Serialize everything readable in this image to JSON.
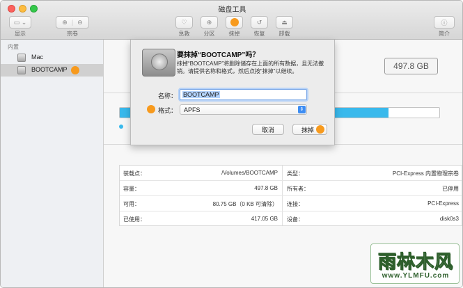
{
  "window": {
    "title": "磁盘工具"
  },
  "toolbar": {
    "view_label": "显示",
    "volume_label": "宗卷",
    "firstaid_label": "急救",
    "partition_label": "分区",
    "erase_label": "抹掉",
    "restore_label": "恢复",
    "unmount_label": "卸载",
    "info_label": "简介"
  },
  "sidebar": {
    "section": "内置",
    "items": [
      {
        "label": "Mac"
      },
      {
        "label": "BOOTCAMP"
      }
    ]
  },
  "main": {
    "capacity": "497.8 GB",
    "usage_fraction": 0.84,
    "info": {
      "rows": [
        {
          "l_label": "装载点：",
          "l_value": "/Volumes/BOOTCAMP",
          "r_label": "类型：",
          "r_value": "PCI-Express 内置物理宗卷"
        },
        {
          "l_label": "容量：",
          "l_value": "497.8 GB",
          "r_label": "所有者：",
          "r_value": "已停用"
        },
        {
          "l_label": "可用：",
          "l_value": "80.75 GB（0 KB 可清除）",
          "r_label": "连接：",
          "r_value": "PCI-Express"
        },
        {
          "l_label": "已使用：",
          "l_value": "417.05 GB",
          "r_label": "设备：",
          "r_value": "disk0s3"
        }
      ]
    }
  },
  "dialog": {
    "title": "要抹掉“BOOTCAMP”吗？",
    "message": "抹掉“BOOTCAMP”将删除储存在上面的所有数据，且无法撤销。请提供名称和格式，然后点按“抹掉”以继续。",
    "name_label": "名称：",
    "name_value": "BOOTCAMP",
    "format_label": "格式：",
    "format_value": "APFS",
    "cancel_label": "取消",
    "erase_label": "抹掉"
  },
  "watermark": {
    "title": "雨林木风",
    "url": "www.YLMFU.com"
  },
  "colors": {
    "accent": "#39b9ec",
    "highlight": "#f79a1d",
    "selection": "#b3d3fd"
  }
}
